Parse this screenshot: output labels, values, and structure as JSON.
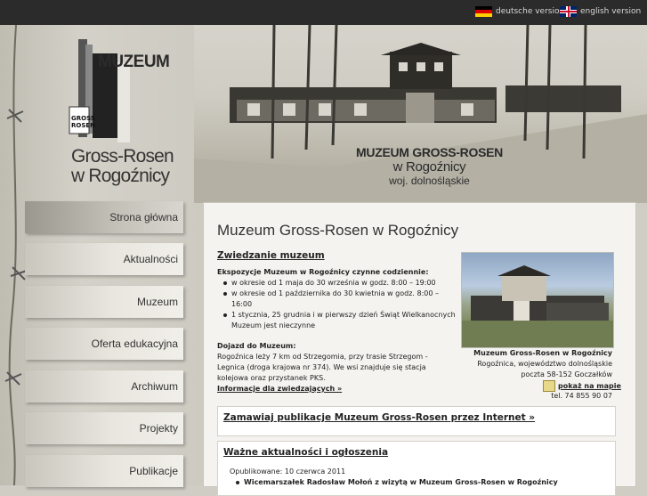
{
  "topbar": {
    "german_label": "deutsche version",
    "english_label": "english version"
  },
  "logo": {
    "word": "MUZEUM",
    "gate_text_1": "GROSS",
    "gate_text_2": "ROSEN",
    "line1": "Gross-Rosen",
    "line2": "w Rogoźnicy"
  },
  "header": {
    "title1": "MUZEUM GROSS-ROSEN",
    "title2": "w Rogoźnicy",
    "title3": "woj. dolnośląskie"
  },
  "nav": {
    "items": [
      {
        "label": "Strona główna"
      },
      {
        "label": "Aktualności"
      },
      {
        "label": "Muzeum"
      },
      {
        "label": "Oferta edukacyjna"
      },
      {
        "label": "Archiwum"
      },
      {
        "label": "Projekty"
      },
      {
        "label": "Publikacje"
      }
    ]
  },
  "main": {
    "title": "Muzeum Gross-Rosen w Rogoźnicy",
    "visit": {
      "title": "Zwiedzanie muzeum",
      "hours_heading": "Ekspozycje Muzeum w Rogoźnicy czynne codziennie:",
      "hours": [
        "w okresie od 1 maja do 30 września w godz. 8:00 – 19:00",
        "w okresie od 1 października do 30 kwietnia w godz. 8:00 – 16:00",
        "1 stycznia, 25 grudnia i w pierwszy dzień Świąt Wielkanocnych Muzeum jest nieczynne"
      ],
      "access_heading": "Dojazd do Muzeum:",
      "access_text": "Rogoźnica leży 7 km od Strzegomia, przy trasie Strzegom - Legnica (droga krajowa nr 374). We wsi znajduje się stacja kolejowa oraz przystanek PKS.",
      "info_link": "Informacje dla zwiedzających »"
    },
    "address": {
      "name": "Muzeum Gross-Rosen w Rogoźnicy",
      "line1": "Rogoźnica, województwo dolnośląskie",
      "line2": "poczta 58-152 Goczałków",
      "map_link": "pokaż na mapie",
      "phone": "tel. 74 855 90 07"
    },
    "order_link": "Zamawiaj publikacje Muzeum Gross-Rosen przez Internet »",
    "news": {
      "title": "Ważne aktualności i ogłoszenia",
      "published": "Opublikowane: 10 czerwca 2011",
      "item": "Wicemarszałek Radosław Mołoń z wizytą w Muzeum Gross-Rosen w Rogoźnicy"
    }
  }
}
